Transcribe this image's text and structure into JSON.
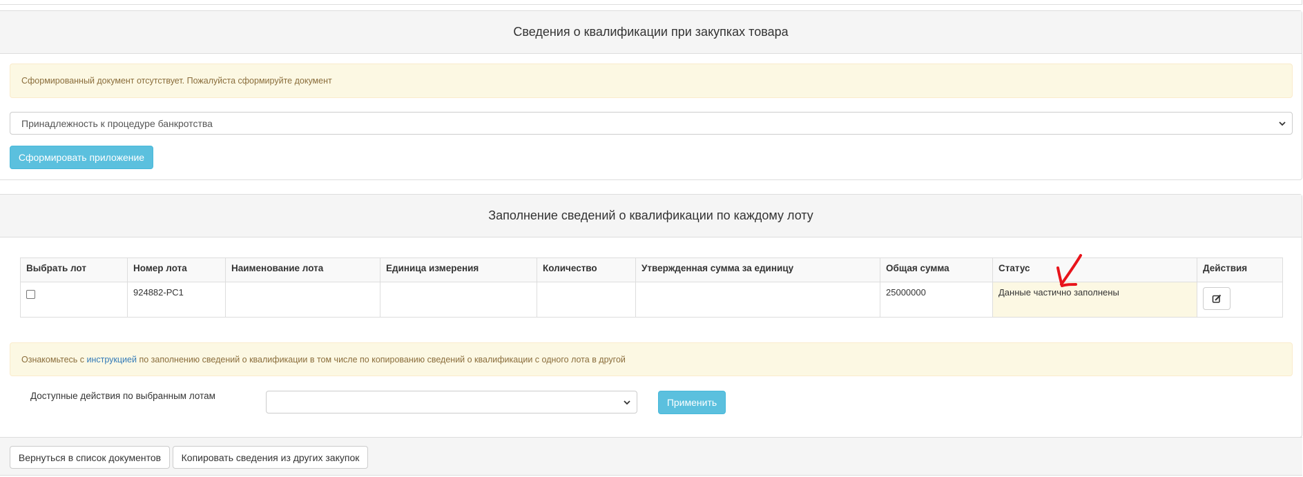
{
  "qualification_panel": {
    "title": "Сведения о квалификации при закупках товара",
    "alert": "Сформированный документ отсутствует. Пожалуйста сформируйте документ",
    "select_value": "Принадлежность к процедуре банкротства",
    "generate_button": "Сформировать приложение"
  },
  "lots_panel": {
    "title": "Заполнение сведений о квалификации по каждому лоту",
    "table": {
      "headers": [
        "Выбрать лот",
        "Номер лота",
        "Наименование лота",
        "Единица измерения",
        "Количество",
        "Утвержденная сумма за единицу",
        "Общая сумма",
        "Статус",
        "Действия"
      ],
      "rows": [
        {
          "lot_number": "924882-РС1",
          "lot_name": "",
          "unit": "",
          "quantity": "",
          "unit_sum": "",
          "total_sum": "25000000",
          "status": "Данные частично заполнены",
          "action_icon": "edit-icon"
        }
      ]
    },
    "info_alert": {
      "prefix": "Ознакомьтесь с ",
      "link": "инструкцией",
      "suffix": " по заполнению сведений о квалификации в том числе по копированию сведений о квалификации с одного лота в другой"
    },
    "bulk_actions_label": "Доступные действия по выбранным лотам",
    "bulk_actions_select_value": "",
    "apply_button": "Применить"
  },
  "footer": {
    "back_button": "Вернуться в список документов",
    "copy_button": "Копировать сведения из других закупок"
  },
  "colors": {
    "info_button": "#5bc0de",
    "warning_bg": "#fcf8e3",
    "warning_text": "#8a6d3b",
    "link": "#337ab7",
    "annotation_mark": "#e8141b"
  }
}
